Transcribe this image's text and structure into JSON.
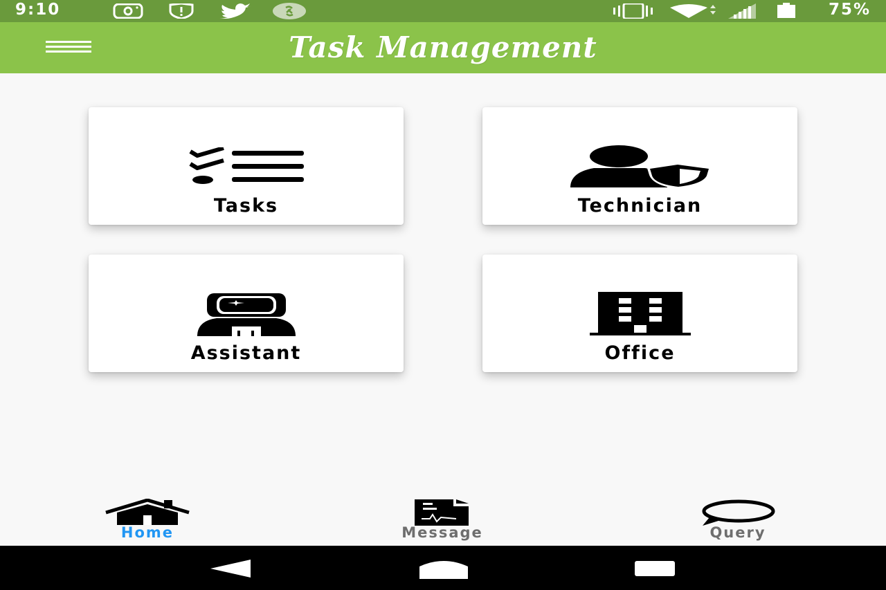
{
  "status_bar": {
    "time": "9:10",
    "battery_text": "75%",
    "icons": [
      "instagram-icon",
      "shield-alert-icon",
      "twitter-icon",
      "shazam-icon",
      "vibrate-icon",
      "wifi-icon",
      "signal-icon",
      "battery-icon"
    ]
  },
  "app_bar": {
    "title": "Task Management",
    "menu_icon": "hamburger-menu-icon"
  },
  "tiles": [
    {
      "label": "Tasks",
      "icon": "checklist-icon"
    },
    {
      "label": "Technician",
      "icon": "user-shield-icon"
    },
    {
      "label": "Assistant",
      "icon": "astronaut-icon"
    },
    {
      "label": "Office",
      "icon": "building-icon"
    }
  ],
  "bottom_nav": [
    {
      "label": "Home",
      "icon": "home-icon",
      "active": true
    },
    {
      "label": "Message",
      "icon": "message-document-icon",
      "active": false
    },
    {
      "label": "Query",
      "icon": "chat-bubble-icon",
      "active": false
    }
  ],
  "colors": {
    "status_bar": "#6a9a3c",
    "app_bar": "#8bc34a",
    "active_nav": "#2196f3",
    "inactive_nav": "#6e6e6e",
    "background": "#f8f8f8"
  },
  "system_nav": [
    "back-icon",
    "home-system-icon",
    "recents-icon"
  ]
}
